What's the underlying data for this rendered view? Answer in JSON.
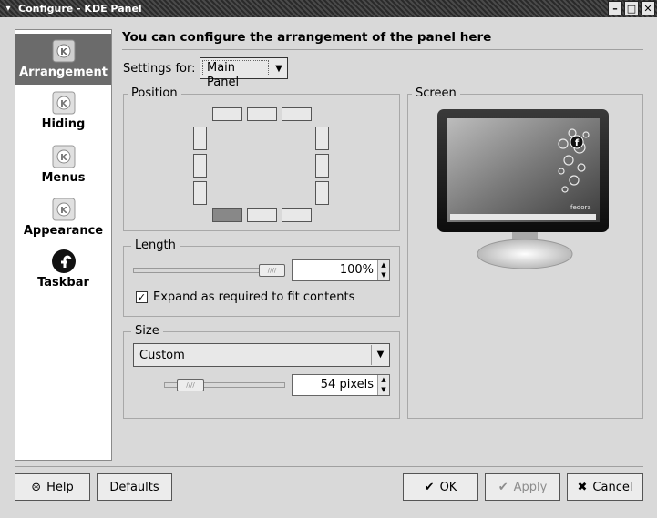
{
  "window": {
    "title": "Configure - KDE Panel",
    "menu_glyph": "▾",
    "minimize_glyph": "–",
    "maximize_glyph": "□",
    "close_glyph": "✕"
  },
  "sidebar": {
    "items": [
      {
        "label": "Arrangement",
        "icon": "kde-gear-icon",
        "active": true
      },
      {
        "label": "Hiding",
        "icon": "kde-gear-icon",
        "active": false
      },
      {
        "label": "Menus",
        "icon": "kde-gear-icon",
        "active": false
      },
      {
        "label": "Appearance",
        "icon": "kde-gear-icon",
        "active": false
      },
      {
        "label": "Taskbar",
        "icon": "fedora-icon",
        "active": false
      }
    ]
  },
  "main": {
    "heading": "You can configure the arrangement of the panel here",
    "settings_for_label": "Settings for:",
    "settings_for_value": "Main Panel",
    "position_title": "Position",
    "screen_title": "Screen",
    "screen_brand": "fedora",
    "length_title": "Length",
    "length_value": "100%",
    "length_fraction": 1.0,
    "expand_label": "Expand as required to fit contents",
    "expand_checked": true,
    "size_title": "Size",
    "size_value": "Custom",
    "size_pixels": "54 pixels"
  },
  "buttons": {
    "help": "Help",
    "defaults": "Defaults",
    "ok": "OK",
    "apply": "Apply",
    "cancel": "Cancel"
  },
  "colors": {
    "selected_slot": "#888888",
    "active_sidebar": "#6b6b6b"
  }
}
